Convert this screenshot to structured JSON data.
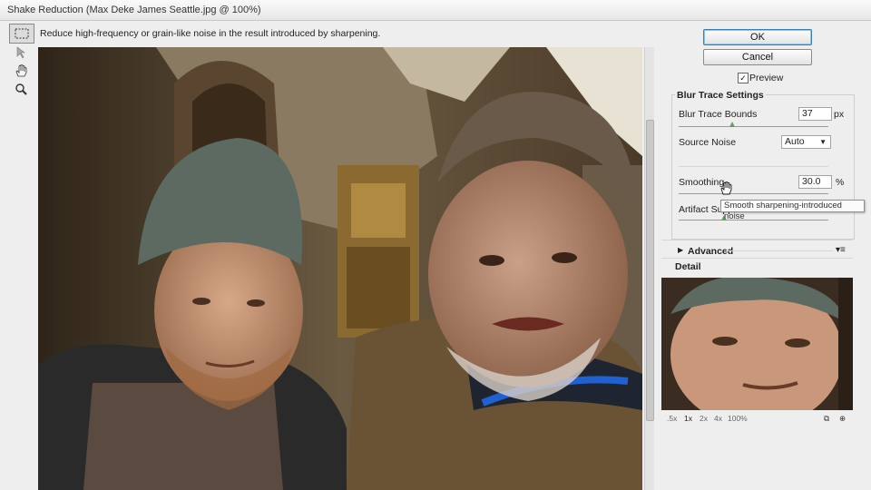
{
  "window": {
    "title": "Shake Reduction (Max Deke James Seattle.jpg @ 100%)"
  },
  "hint": "Reduce high-frequency or grain-like noise in the result introduced by sharpening.",
  "tools": [
    "marquee-icon",
    "blur-trace-tool-icon",
    "hand-icon",
    "zoom-icon"
  ],
  "buttons": {
    "ok": "OK",
    "cancel": "Cancel"
  },
  "preview": {
    "label": "Preview",
    "checked": true
  },
  "blur_trace": {
    "heading": "Blur Trace Settings",
    "bounds_label": "Blur Trace Bounds",
    "bounds_value": "37",
    "bounds_unit": "px",
    "source_noise_label": "Source Noise",
    "source_noise_value": "Auto",
    "smoothing_label": "Smoothing",
    "smoothing_value": "30.0",
    "smoothing_unit": "%",
    "artifact_label": "Artifact Supp"
  },
  "tooltip": "Smooth sharpening-introduced noise",
  "advanced": {
    "label": "Advanced"
  },
  "detail": {
    "label": "Detail",
    "zoom_levels": [
      ".5x",
      "1x",
      "2x",
      "4x",
      "100%"
    ],
    "selected_zoom": "1x"
  },
  "colors": {
    "accent": "#3c7fb1",
    "panel": "#eeeeee"
  }
}
